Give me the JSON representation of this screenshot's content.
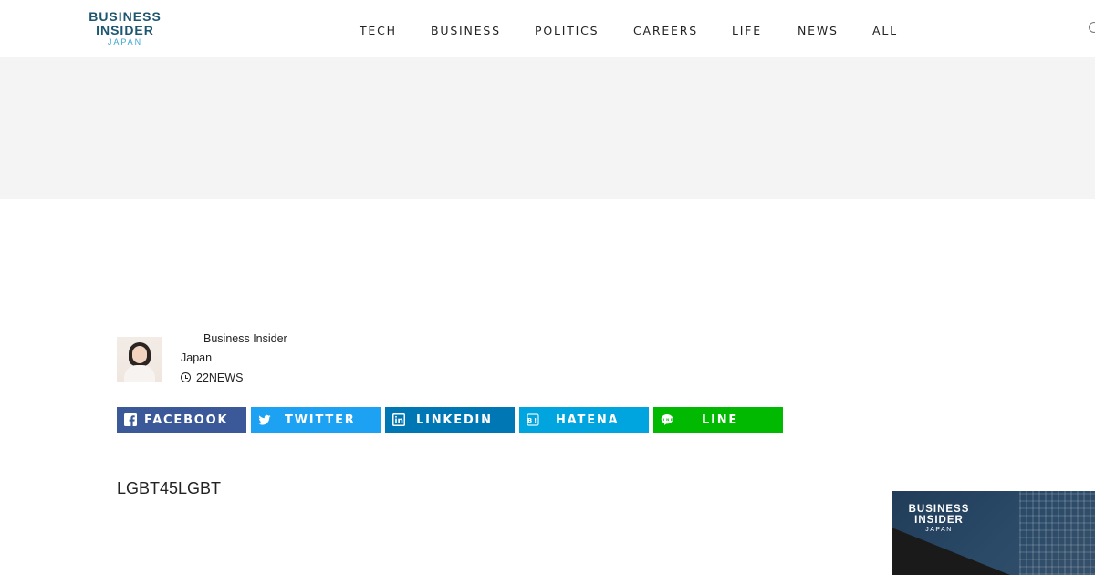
{
  "logo": {
    "line1": "BUSINESS",
    "line2": "INSIDER",
    "line3": "JAPAN"
  },
  "nav": {
    "items": [
      "TECH",
      "BUSINESS",
      "POLITICS",
      "CAREERS",
      "LIFE",
      "NEWS",
      "ALL"
    ]
  },
  "author": {
    "name_line1": "Business Insider",
    "name_line2": "Japan",
    "meta": "22NEWS"
  },
  "share": {
    "facebook": "FACEBOOK",
    "twitter": "TWITTER",
    "linkedin": "LINKEDIN",
    "hatena": "HATENA",
    "line": "LINE"
  },
  "article": {
    "text": "LGBT45LGBT"
  },
  "promo": {
    "line1": "BUSINESS",
    "line2": "INSIDER",
    "line3": "JAPAN"
  },
  "colors": {
    "brand": "#1d5670",
    "accent": "#3ea6cf",
    "facebook": "#3b5998",
    "twitter": "#1da1f2",
    "linkedin": "#0077b5",
    "hatena": "#00a4de",
    "line": "#00b900"
  },
  "icons": [
    "search-icon",
    "clock-icon",
    "facebook-icon",
    "twitter-icon",
    "linkedin-icon",
    "hatena-icon",
    "line-icon"
  ]
}
